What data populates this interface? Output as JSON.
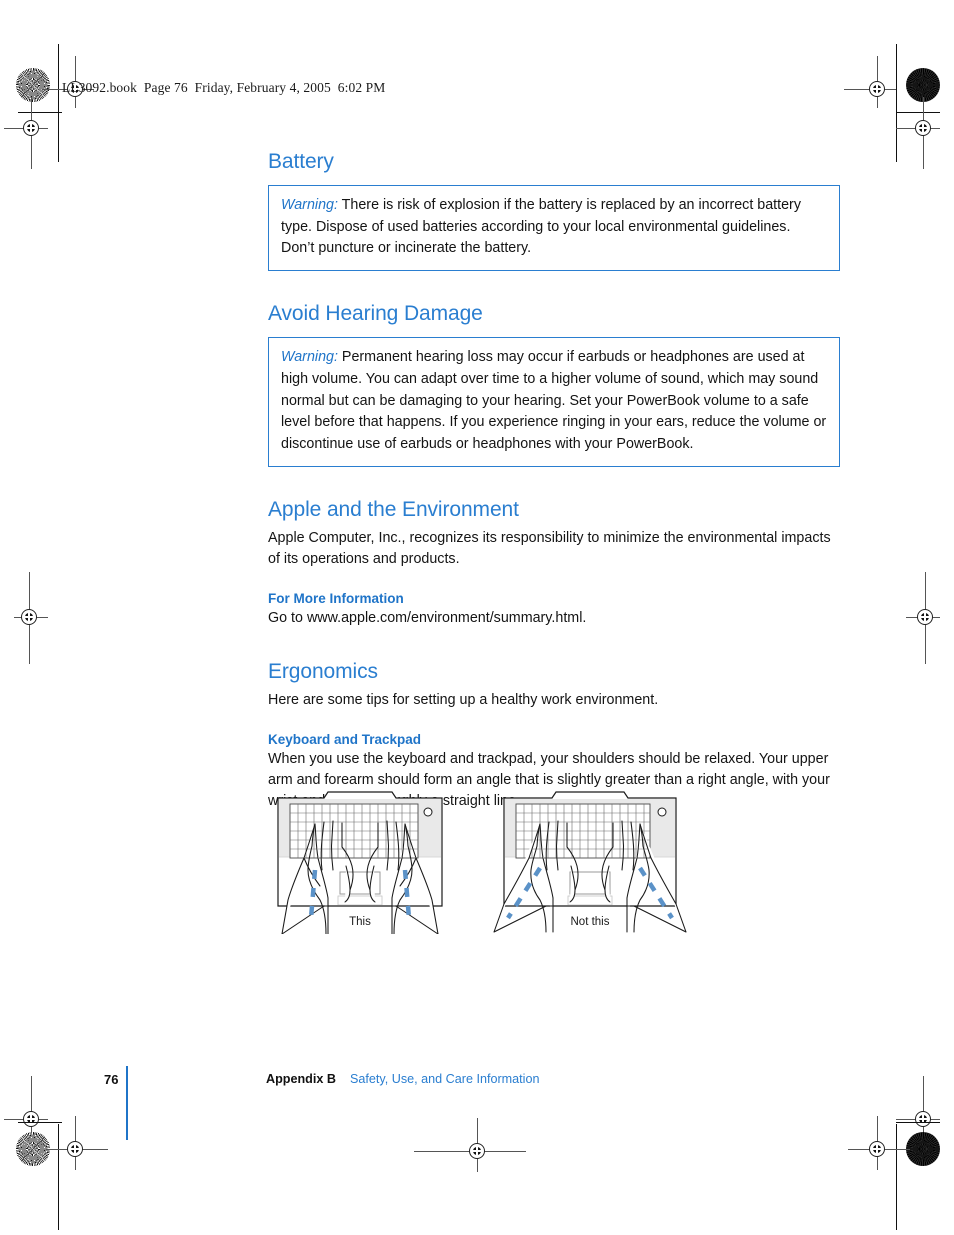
{
  "page": {
    "file_header": "LL3092.book  Page 76  Friday, February 4, 2005  6:02 PM",
    "accent_color": "#2a7ed0",
    "subhead_color": "#1f74c8"
  },
  "sections": [
    {
      "heading": "Battery",
      "warning": {
        "label": "Warning:",
        "text": " There is risk of explosion if the battery is replaced by an incorrect battery type. Dispose of used batteries according to your local environmental guidelines. Don’t puncture or incinerate the battery."
      }
    },
    {
      "heading": "Avoid Hearing Damage",
      "warning": {
        "label": "Warning:",
        "text": "  Permanent hearing loss may occur if earbuds or headphones are used at high volume. You can adapt over time to a higher volume of sound, which may sound normal but can be damaging to your hearing. Set your PowerBook volume to a safe level before that happens. If you experience ringing in your ears, reduce the volume or discontinue use of earbuds or headphones with your PowerBook."
      }
    },
    {
      "heading": "Apple and the Environment",
      "body": "Apple Computer, Inc., recognizes its responsibility to minimize the environmental impacts of its operations and products.",
      "subheading": "For More Information",
      "sub_body": "Go to www.apple.com/environment/summary.html."
    },
    {
      "heading": "Ergonomics",
      "body": "Here are some tips for setting up a healthy work environment.",
      "subheading": "Keyboard and Trackpad",
      "sub_body": "When you use the keyboard and trackpad, your shoulders should be relaxed. Your upper arm and forearm should form an angle that is slightly greater than a right angle, with your wrist and hand in roughly a straight line."
    }
  ],
  "figures": [
    {
      "caption": "This",
      "posture": "correct"
    },
    {
      "caption": "Not this",
      "posture": "incorrect"
    }
  ],
  "footer": {
    "page_number": "76",
    "chapter": "Appendix B",
    "title": "Safety, Use, and Care Information"
  }
}
